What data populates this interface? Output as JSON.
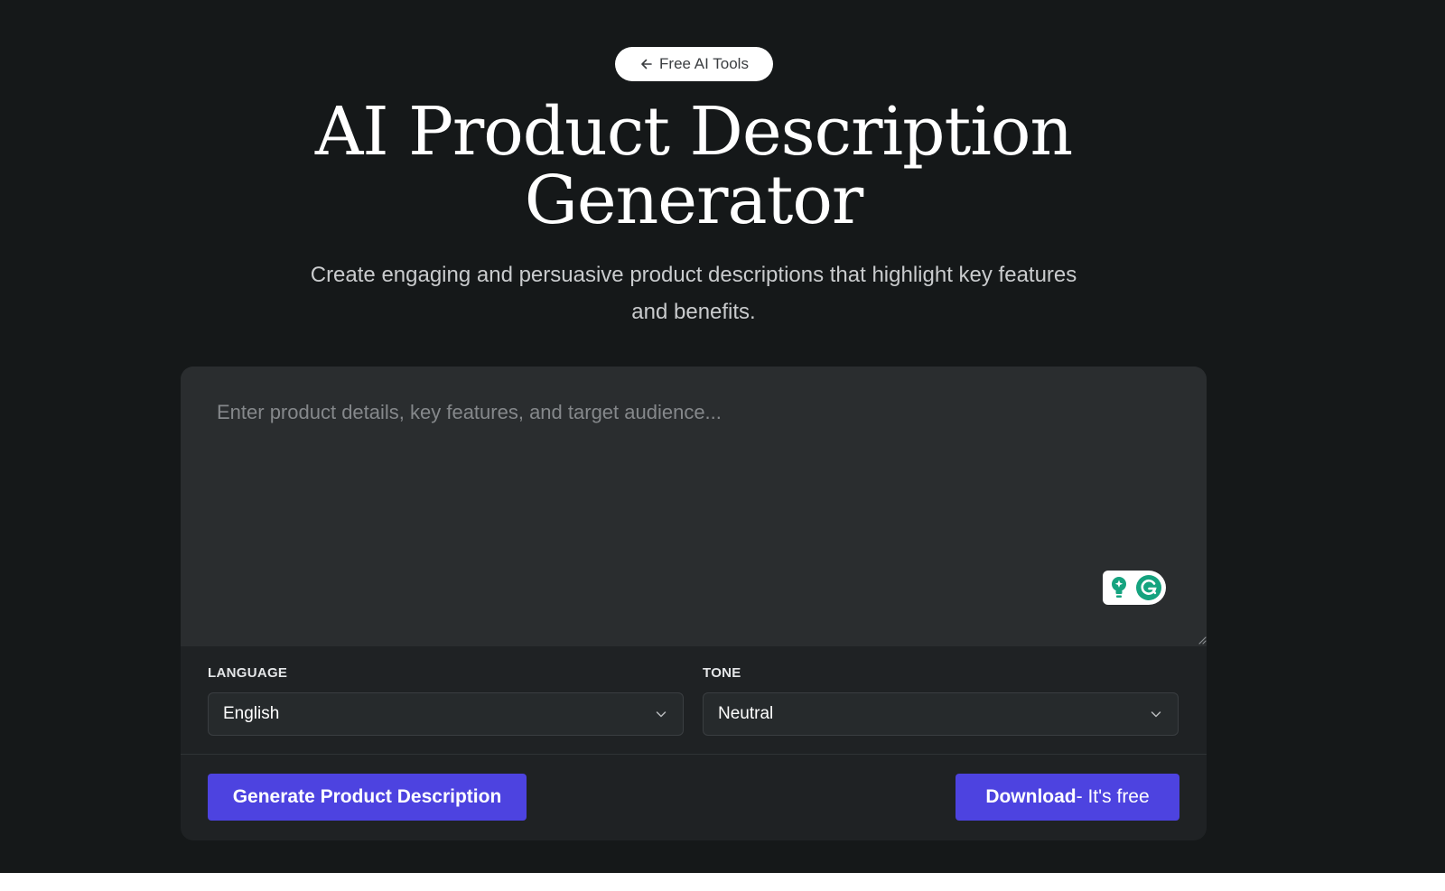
{
  "header": {
    "back_label": "Free AI Tools",
    "title_line1": "AI Product Description",
    "title_line2": "Generator",
    "subtitle_line1": "Create engaging and persuasive product descriptions that highlight key features",
    "subtitle_line2": "and benefits."
  },
  "form": {
    "input_placeholder": "Enter product details, key features, and target audience...",
    "input_value": "",
    "language": {
      "label": "LANGUAGE",
      "selected": "English"
    },
    "tone": {
      "label": "TONE",
      "selected": "Neutral"
    },
    "generate_label": "Generate Product Description",
    "download_label_strong": "Download",
    "download_label_rest": "- It's free"
  },
  "icons": {
    "back": "arrow-left-icon",
    "chevron": "chevron-down-icon",
    "grammarly": "grammarly-icon",
    "suggestion": "lightbulb-icon"
  },
  "colors": {
    "background": "#151819",
    "card": "#1f2224",
    "input": "#2a2d2f",
    "accent": "#4d43e0",
    "grammarly_green": "#15a37f"
  }
}
